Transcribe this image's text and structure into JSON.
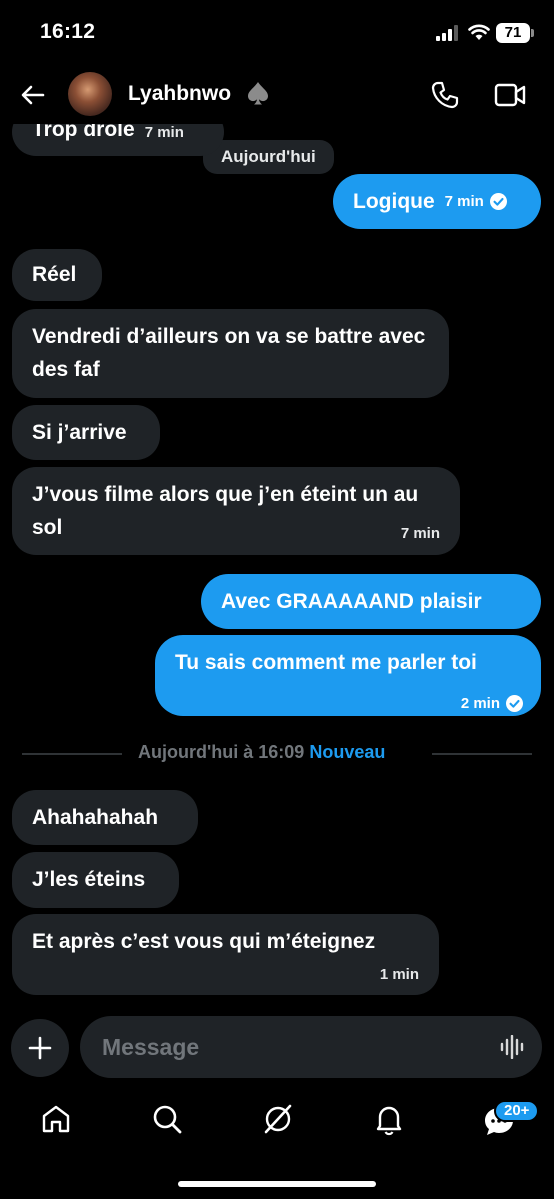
{
  "status_bar": {
    "time": "16:12",
    "battery": "71"
  },
  "header": {
    "contact_name": "Lyahbnwo"
  },
  "messages": [
    {
      "text": "Trop drôle",
      "meta": "7 min"
    },
    {
      "text": "Logique",
      "meta": "7 min"
    },
    {
      "text": "Réel"
    },
    {
      "text": "Vendredi d’ailleurs on va se battre avec des faf"
    },
    {
      "text": "Si j’arrive"
    },
    {
      "text": "J’vous filme alors que j’en éteint un au sol",
      "meta": "7 min"
    },
    {
      "text": "Avec GRAAAAAND plaisir"
    },
    {
      "text": "Tu sais comment me parler toi",
      "meta": "2 min"
    },
    {
      "text": "Ahahahahah"
    },
    {
      "text": "J’les éteins"
    },
    {
      "text": "Et après c’est vous qui m’éteignez",
      "meta": "1 min"
    }
  ],
  "day_pill": "Aujourd'hui",
  "divider": {
    "text": "Aujourd'hui à 16:09",
    "new_label": "Nouveau"
  },
  "composer": {
    "placeholder": "Message"
  },
  "tabs": {
    "messages_badge": "20+"
  },
  "icons": {
    "back": "arrow-left-icon",
    "spade": "spade-icon",
    "phone": "phone-icon",
    "video": "video-camera-icon",
    "plus": "plus-icon",
    "voice": "waveform-icon",
    "home": "home-icon",
    "search": "search-icon",
    "grok": "grok-icon",
    "notifications": "bell-icon",
    "messages": "messages-icon"
  },
  "colors": {
    "accent": "#1d9bf0",
    "incoming_bubble": "#1f2327",
    "background": "#000000"
  }
}
